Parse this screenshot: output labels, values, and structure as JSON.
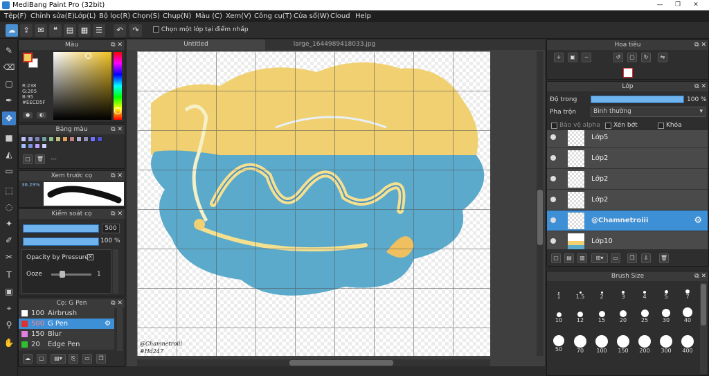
{
  "app": {
    "title": "MediBang Paint Pro (32bit)"
  },
  "menu": [
    "Tệp(F)",
    "Chỉnh sửa(E)",
    "Lớp(L)",
    "Bộ lọc(R)",
    "Chọn(S)",
    "Chụp(N)",
    "Màu (C)",
    "Xem(V)",
    "Công cụ(T)",
    "Cửa sổ(W)",
    "Cloud",
    "Help"
  ],
  "toolbar": {
    "select_layer_label": "Chọn một lớp tại điểm nhấp"
  },
  "color_panel": {
    "title": "Màu",
    "r": "R:238",
    "g": "G:205",
    "b": "B:95",
    "hex": "#EECD5F",
    "fg": "#EECD5F",
    "bg": "#ffffff"
  },
  "palette_panel": {
    "title": "Bảng màu",
    "dash": "---",
    "swatches": [
      "#c0c0ff",
      "#a0a0e0",
      "#8080c0",
      "#70a0a0",
      "#8fbf8f",
      "#c0c080",
      "#e0a060",
      "#c08080",
      "#b0b0d0",
      "#9090b0",
      "#7070ff",
      "#5050d0",
      "#a0c0ff",
      "#8090e0",
      "#c0a0ff",
      "#d0d0ff"
    ]
  },
  "preview_panel": {
    "title": "Xem trước cọ",
    "zoom": "36.29%"
  },
  "brush_control": {
    "title": "Kiểm soát cọ",
    "size": "500",
    "opacity": "100 %",
    "pressure_label": "Opacity by Pressure",
    "ooze_label": "Ooze",
    "ooze_value": "1"
  },
  "brush_list": {
    "title": "Cọ: G Pen",
    "items": [
      {
        "size": "100",
        "name": "Airbrush",
        "color": "#ffffff"
      },
      {
        "size": "500",
        "name": "G Pen",
        "color": "#e03030"
      },
      {
        "size": "150",
        "name": "Blur",
        "color": "#e080e0"
      },
      {
        "size": "20",
        "name": "Edge Pen",
        "color": "#30c030"
      }
    ]
  },
  "canvas": {
    "tabs": [
      "Untitled",
      "large_1644989418033.jpg"
    ],
    "watermark1": "@Chamnetroiii",
    "watermark2": "#Hd247",
    "art_text": "Holiday"
  },
  "navigator": {
    "title": "Hoa tiêu"
  },
  "layer_panel": {
    "title": "Lớp",
    "opacity_label": "Độ trong",
    "opacity_value": "100 %",
    "blend_label": "Pha trộn",
    "blend_value": "Bình thường",
    "alpha_label": "Bảo vệ alpha",
    "clip_label": "Xén bớt",
    "lock_label": "Khóa",
    "layers": [
      "Lớp5",
      "Lớp2",
      "Lớp2",
      "Lớp2",
      "@Chamnetroiii",
      "Lớp10"
    ],
    "selected": 4
  },
  "brush_size": {
    "title": "Brush Size",
    "sizes": [
      "1",
      "1.5",
      "2",
      "3",
      "4",
      "5",
      "7",
      "10",
      "12",
      "15",
      "20",
      "25",
      "30",
      "40",
      "50",
      "70",
      "100",
      "150",
      "200",
      "300",
      "400"
    ]
  }
}
